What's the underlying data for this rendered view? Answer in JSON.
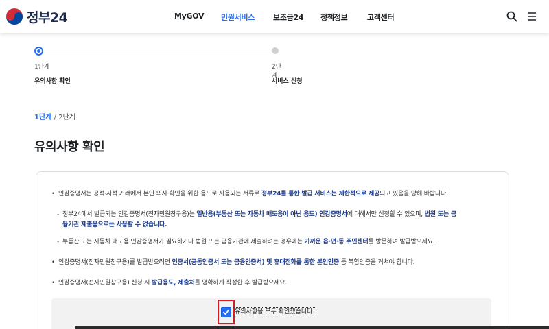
{
  "header": {
    "logo_text": "정부24",
    "nav": [
      {
        "label": "MyGOV",
        "active": false
      },
      {
        "label": "민원서비스",
        "active": true
      },
      {
        "label": "보조금24",
        "active": false
      },
      {
        "label": "정책정보",
        "active": false
      },
      {
        "label": "고객센터",
        "active": false
      }
    ],
    "icons": [
      "search-icon",
      "menu-icon"
    ]
  },
  "stepper": {
    "steps": [
      {
        "num": "1단계",
        "name": "유의사항 확인",
        "active": true
      },
      {
        "num": "2단계",
        "name": "서비스 신청",
        "active": false
      }
    ]
  },
  "breadcrumb": {
    "current": "1단계",
    "separator": "/",
    "next": "2단계"
  },
  "page_title": "유의사항 확인",
  "notice": {
    "items": [
      {
        "type": "bullet",
        "parts": [
          {
            "t": "인감증명서는 공적·사적 거래에서 본인 의사 확인을 위한 용도로 사용되는 서류로 ",
            "b": false
          },
          {
            "t": "정부24를 통한 발급 서비스는 제한적으로 제공",
            "b": true
          },
          {
            "t": "되고 있음을 양해 바랍니다.",
            "b": false
          }
        ]
      },
      {
        "type": "dash",
        "line1": [
          {
            "t": "정부24에서 발급되는 인감증명서(전자민원창구용)는 ",
            "b": false
          },
          {
            "t": "일반용(부동산 또는 자동차 매도용이 아닌 용도) 인감증명서",
            "b": true
          },
          {
            "t": "에 대해서만 신청할 수 있으며, ",
            "b": false
          },
          {
            "t": "법원 또는 금",
            "b": true
          }
        ],
        "line2": [
          {
            "t": "융기관 제출용으로는 사용할 수 없습니다.",
            "b": true
          }
        ]
      },
      {
        "type": "dash",
        "parts": [
          {
            "t": "부동산 또는 자동차 매도용 인감증명서가 필요하거나 법원 또는 금융기관에 제출하려는 경우에는 ",
            "b": false
          },
          {
            "t": "가까운 읍·면·동 주민센터",
            "b": true
          },
          {
            "t": "를 방문하여 발급받으세요.",
            "b": false
          }
        ]
      },
      {
        "type": "bullet",
        "parts": [
          {
            "t": "인감증명서(전자민원창구용)를 발급받으려면 ",
            "b": false
          },
          {
            "t": "인증서(공동인증서 또는 금융인증서) 및 휴대전화를 통한 본인인증",
            "b": true
          },
          {
            "t": " 등 복합인증을 거쳐야 합니다.",
            "b": false
          }
        ]
      },
      {
        "type": "bullet",
        "parts": [
          {
            "t": "인감증명서(전자민원창구용) 신청 시 ",
            "b": false
          },
          {
            "t": "발급용도, 제출처",
            "b": true
          },
          {
            "t": "를 명확하게 작성한 후 발급받으세요.",
            "b": false
          }
        ]
      }
    ]
  },
  "confirm": {
    "label": "유의사항을 모두 확인했습니다.",
    "checked": true
  },
  "colors": {
    "accent": "#256ef4",
    "highlight": "#e0191e",
    "bold_text": "#1b3a8c"
  }
}
